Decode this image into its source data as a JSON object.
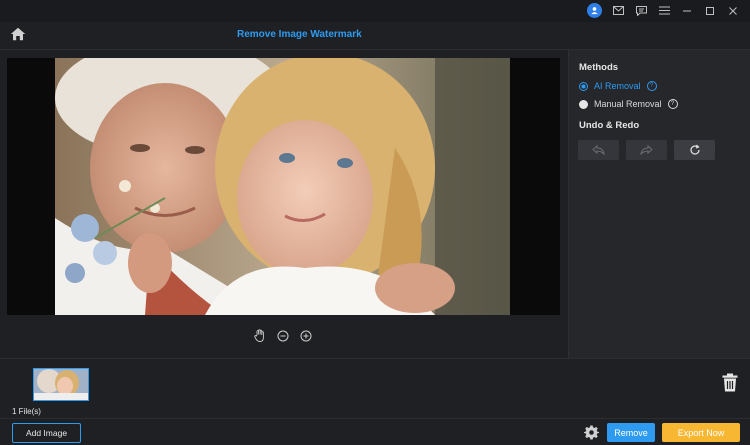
{
  "header": {
    "title": "Remove Image Watermark"
  },
  "right_panel": {
    "methods_title": "Methods",
    "methods": [
      {
        "label": "AI Removal",
        "selected": true
      },
      {
        "label": "Manual Removal",
        "selected": false
      }
    ],
    "undo_redo_title": "Undo & Redo"
  },
  "files": {
    "count_label": "1 File(s)"
  },
  "footer": {
    "add_image_label": "Add Image",
    "remove_label": "Remove",
    "export_label": "Export Now"
  },
  "colors": {
    "accent": "#2e9bf0",
    "export": "#f7b733",
    "background": "#1f2023",
    "panel": "#26272b"
  },
  "icons": {
    "titlebar": [
      "user-avatar-icon",
      "mail-icon",
      "feedback-icon",
      "menu-icon",
      "minimize-icon",
      "maximize-icon",
      "close-icon"
    ],
    "canvas_tools": [
      "hand-icon",
      "zoom-out-icon",
      "zoom-in-icon"
    ]
  }
}
